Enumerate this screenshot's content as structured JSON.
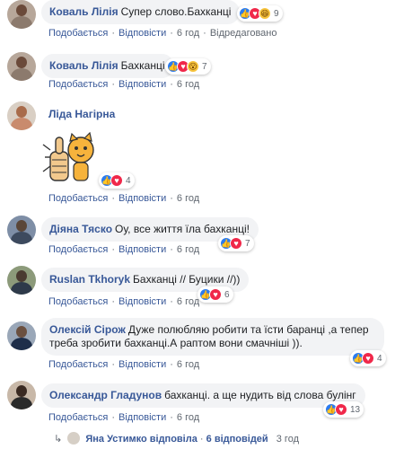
{
  "comments": [
    {
      "author": "Коваль Лілія",
      "text": "Супер слово.Бахканці",
      "reaction_count": "9",
      "like": "Подобається",
      "reply": "Відповісти",
      "time": "6 год",
      "extra": "Відредаговано"
    },
    {
      "author": "Коваль Лілія",
      "text": "Бахканці",
      "reaction_count": "7",
      "like": "Подобається",
      "reply": "Відповісти",
      "time": "6 год"
    },
    {
      "author": "Ліда Нагірна",
      "text": "",
      "reaction_count": "4",
      "like": "Подобається",
      "reply": "Відповісти",
      "time": "6 год"
    },
    {
      "author": "Діяна Тяско",
      "text": "Оу, все життя їла бахканці!",
      "reaction_count": "7",
      "like": "Подобається",
      "reply": "Відповісти",
      "time": "6 год"
    },
    {
      "author": "Ruslan Tkhoryk",
      "text": "Бахканці // Буцики //))",
      "reaction_count": "6",
      "like": "Подобається",
      "reply": "Відповісти",
      "time": "6 год"
    },
    {
      "author": "Олексій Сірож",
      "text": "Дуже полюбляю робити та їсти баранці ,а тепер треба зробити бахканці.А раптом вони смачніші )).",
      "reaction_count": "4",
      "like": "Подобається",
      "reply": "Відповісти",
      "time": "6 год"
    },
    {
      "author": "Олександр Гладунов",
      "text": "бахканці. а ще нудить від слова булінг",
      "reaction_count": "13",
      "like": "Подобається",
      "reply": "Відповісти",
      "time": "6 год"
    }
  ],
  "replies_bar": {
    "who": "Яна Устимко відповіла",
    "dot": "·",
    "count": "6 відповідей",
    "time": "3 год"
  },
  "colors": {
    "link": "#385898",
    "bubble": "#f2f3f5",
    "meta": "#606770",
    "like": "#2b7cf0",
    "love": "#f0284a"
  }
}
